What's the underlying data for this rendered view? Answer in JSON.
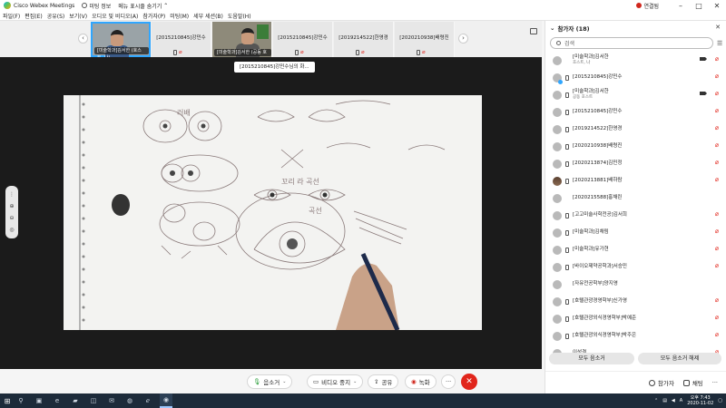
{
  "titlebar": {
    "app_title": "Cisco Webex Meetings",
    "meeting_info": "미팅 정보",
    "hide_menu": "메뉴 표시줄 숨기기",
    "connection": "연결됨"
  },
  "menu": [
    "파일(F)",
    "편집(E)",
    "공유(S)",
    "보기(V)",
    "오디오 및 비디오(A)",
    "참가자(P)",
    "미팅(M)",
    "세부 세션(B)",
    "도움말(H)"
  ],
  "strip": {
    "thumbs": [
      {
        "video_label": "[미술학과]김서한 (호스트, 나)"
      },
      {
        "name": "[2015210845]강민수"
      },
      {
        "video_label": "[미술학과]김서한 (공동 호스트)"
      },
      {
        "name": "[2015210845]강민수"
      },
      {
        "name": "[2019214522]한영경"
      },
      {
        "name": "[2020210938]배령진"
      }
    ]
  },
  "stage": {
    "share_badge": "[2015210845]강민수님의 화..."
  },
  "panel": {
    "title": "참가자 (18)",
    "search_placeholder": "검색",
    "participants": [
      {
        "name": "[미술학과]김서한",
        "role": "호스트, 나"
      },
      {
        "name": "[2015210845]강민수",
        "role": ""
      },
      {
        "name": "[미술학과]김서한",
        "role": "공동 호스트"
      },
      {
        "name": "[2015210845]강민수",
        "role": ""
      },
      {
        "name": "[2019214522]한영경",
        "role": ""
      },
      {
        "name": "[2020210938]배령진",
        "role": ""
      },
      {
        "name": "[2020213874]김민정",
        "role": ""
      },
      {
        "name": "[2020213881]배하람",
        "role": ""
      },
      {
        "name": "[2020215588]홍채린",
        "role": ""
      },
      {
        "name": "[고고미술사학전공]김서희",
        "role": ""
      },
      {
        "name": "[미술학과]김채림",
        "role": ""
      },
      {
        "name": "[미술학과]유가현",
        "role": ""
      },
      {
        "name": "[바이오제약공학과]서승민",
        "role": ""
      },
      {
        "name": "[자유전공학부]양지영",
        "role": ""
      },
      {
        "name": "[호텔관광경영학부]신가영",
        "role": ""
      },
      {
        "name": "[호텔관광외식경영학부]박예준",
        "role": ""
      },
      {
        "name": "[호텔관광외식경영학부]박주은",
        "role": ""
      },
      {
        "name": "이성결",
        "role": ""
      }
    ],
    "mute_all": "모두 음소거",
    "unmute_all": "모두 음소거 해제",
    "tab_participants": "참가자",
    "tab_chat": "채팅"
  },
  "controls": {
    "mute": "음소거",
    "stop_video": "비디오 중지",
    "share": "공유",
    "record": "녹화",
    "more": "···",
    "end": "✕"
  },
  "taskbar": {
    "time": "오후 7:43",
    "date": "2020-11-02"
  },
  "sketch_text": {
    "t1": "러배",
    "t2": "꼬리 라 곡선",
    "t3": "곡선"
  }
}
